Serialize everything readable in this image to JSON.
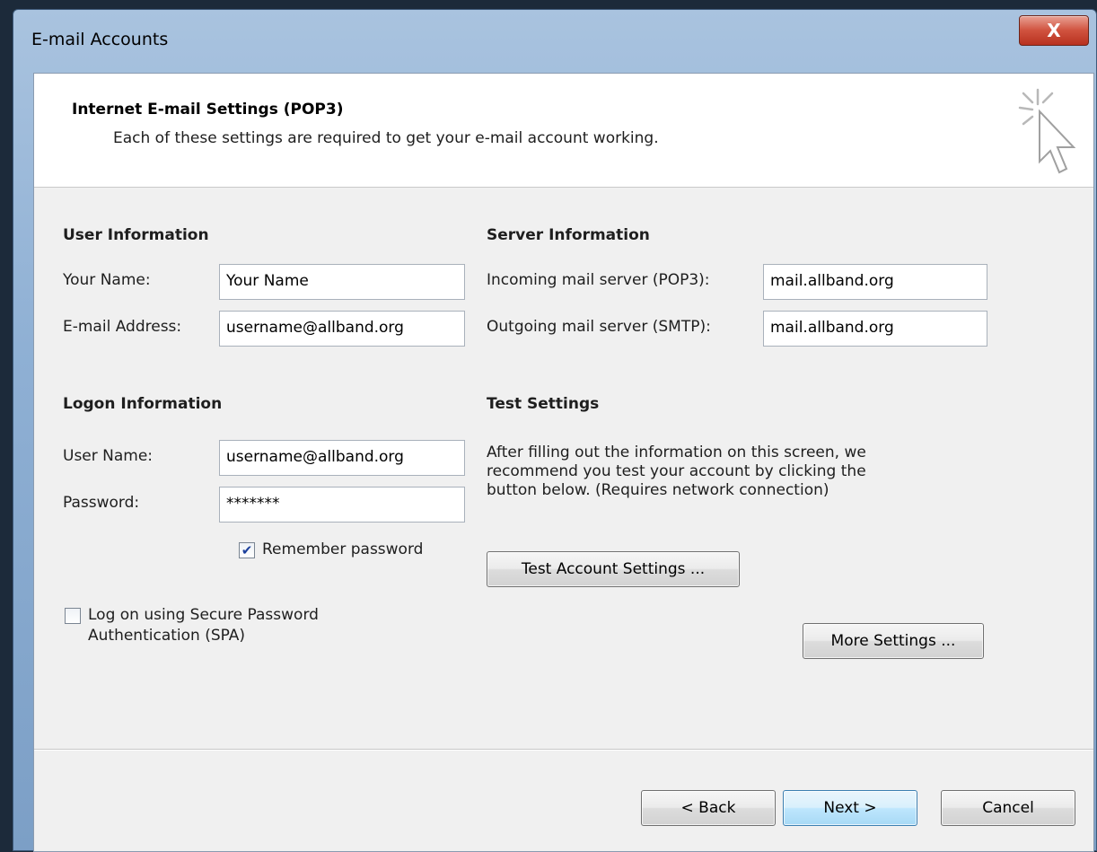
{
  "window": {
    "title": "E-mail Accounts",
    "close_label": "X"
  },
  "header": {
    "title": "Internet E-mail Settings (POP3)",
    "subtitle": "Each of these settings are required to get your e-mail account working."
  },
  "user_info": {
    "section_title": "User Information",
    "name_label": "Your Name:",
    "name_value": "Your Name",
    "email_label": "E-mail Address:",
    "email_value": "username@allband.org"
  },
  "server_info": {
    "section_title": "Server Information",
    "incoming_label": "Incoming mail server (POP3):",
    "incoming_value": "mail.allband.org",
    "outgoing_label": "Outgoing mail server (SMTP):",
    "outgoing_value": "mail.allband.org"
  },
  "logon_info": {
    "section_title": "Logon Information",
    "username_label": "User Name:",
    "username_value": "username@allband.org",
    "password_label": "Password:",
    "password_value": "*******",
    "remember_label": "Remember password",
    "remember_checked": true,
    "spa_label_line1": "Log on using Secure Password",
    "spa_label_line2": "Authentication (SPA)",
    "spa_checked": false
  },
  "test_settings": {
    "section_title": "Test Settings",
    "line1": "After filling out the information on this screen, we",
    "line2": "recommend you test your account by clicking the",
    "line3": "button below. (Requires network connection)",
    "test_button": "Test Account Settings ..."
  },
  "more_settings_button": "More Settings ...",
  "footer": {
    "back_button": "< Back",
    "next_button": "Next >",
    "cancel_button": "Cancel"
  },
  "colors": {
    "client_bg": "#f0f0f0",
    "header_bg": "#ffffff",
    "default_button_border": "#3c7fb1",
    "close_button": "#c94530"
  }
}
